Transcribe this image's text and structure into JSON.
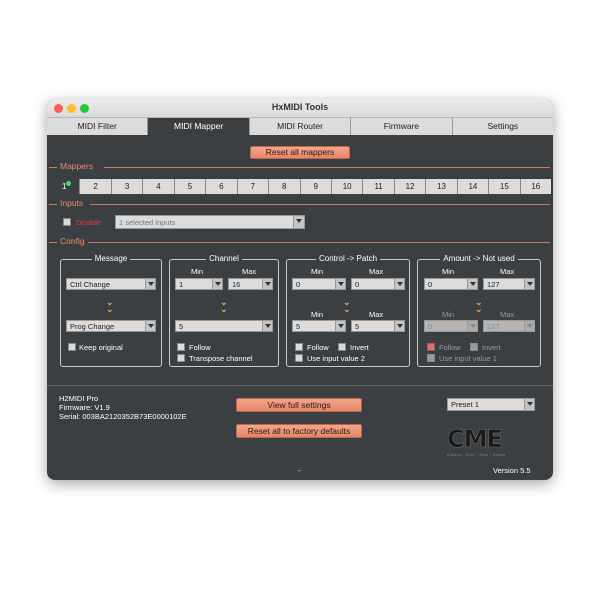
{
  "window": {
    "title": "HxMIDI Tools"
  },
  "tabs": [
    "MIDI Filter",
    "MIDI Mapper",
    "MIDI Router",
    "Firmware",
    "Settings"
  ],
  "reset_all_mappers": "Reset all mappers",
  "sections": {
    "mappers": "Mappers",
    "inputs": "Inputs",
    "config": "Config"
  },
  "mappers": [
    "1",
    "2",
    "3",
    "4",
    "5",
    "6",
    "7",
    "8",
    "9",
    "10",
    "11",
    "12",
    "13",
    "14",
    "15",
    "16"
  ],
  "inputs": {
    "disable_label": "Disable",
    "selected": "1 selected inputs"
  },
  "message": {
    "title": "Message",
    "type": "Ctrl Change",
    "target": "Prog Change",
    "keep_original": "Keep original"
  },
  "channel": {
    "title": "Channel",
    "min_label": "Min",
    "max_label": "Max",
    "min": "1",
    "max": "16",
    "target": "5",
    "follow": "Follow",
    "transpose": "Transpose channel"
  },
  "control": {
    "title": "Control -> Patch",
    "min_label": "Min",
    "max_label": "Max",
    "min": "0",
    "max": "0",
    "out_min_label": "Min",
    "out_max_label": "Max",
    "out_min": "5",
    "out_max": "5",
    "follow": "Follow",
    "invert": "Invert",
    "use_input": "Use input value 2"
  },
  "amount": {
    "title": "Amount -> Not used",
    "min_label": "Min",
    "max_label": "Max",
    "min": "0",
    "max": "127",
    "out_min_label": "Min",
    "out_max_label": "Max",
    "out_min": "0",
    "out_max": "127",
    "follow": "Follow",
    "invert": "Invert",
    "use_input": "Use input value 1"
  },
  "device": {
    "name": "H2MIDI Pro",
    "firmware": "Firmware: V1.9",
    "serial": "Serial: 003BA2120352B73E0000102E"
  },
  "view_full_settings": "View full settings",
  "reset_factory": "Reset all to factory defaults",
  "preset": "Preset 1",
  "logo": {
    "text": "CME",
    "tagline": "Always · Give · Step · ahead"
  },
  "dash": "-",
  "version": "Version 5.5",
  "colors": {
    "accent": "#f08a63",
    "panel": "#3a3f44",
    "led": "#3ee06a"
  }
}
